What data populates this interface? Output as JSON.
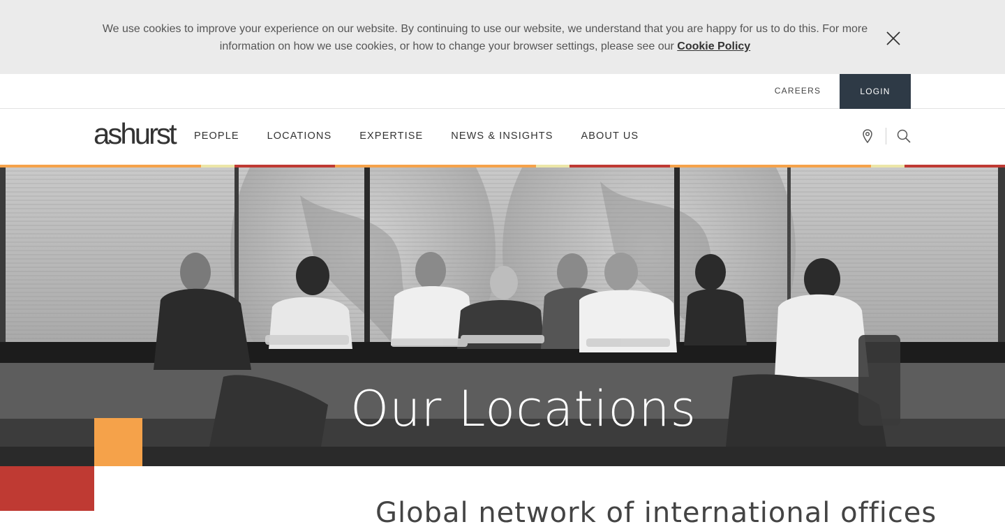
{
  "cookie_banner": {
    "text": "We use cookies to improve your experience on our website. By continuing to use our website, we understand that you are happy for us to do this. For more information on how we use cookies, or how to change your browser settings, please see our ",
    "link_label": "Cookie Policy",
    "close_icon": "close-icon"
  },
  "utility_nav": {
    "careers_label": "CAREERS",
    "login_label": "LOGIN"
  },
  "brand": {
    "logo_text": "ashurst"
  },
  "main_nav": {
    "items": [
      {
        "label": "PEOPLE"
      },
      {
        "label": "LOCATIONS"
      },
      {
        "label": "EXPERTISE"
      },
      {
        "label": "NEWS & INSIGHTS"
      },
      {
        "label": "ABOUT US"
      }
    ],
    "location_icon": "map-pin-icon",
    "search_icon": "search-icon"
  },
  "hero": {
    "title": "Our Locations"
  },
  "intro": {
    "heading_partial": "Global network of international offices"
  },
  "colors": {
    "banner_bg": "#ebebeb",
    "login_bg": "#2e3a46",
    "orange": "#f5a24a",
    "red": "#bf3a33",
    "pale_yellow": "#ece6a8"
  }
}
